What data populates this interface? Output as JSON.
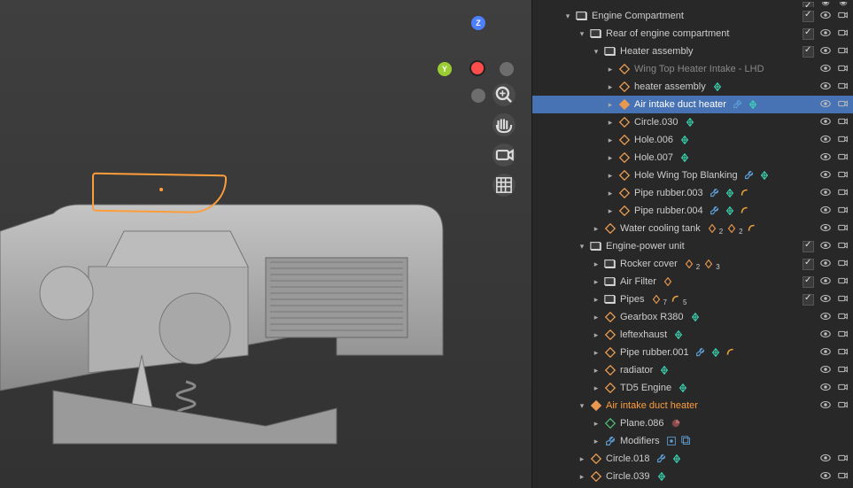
{
  "viewport": {
    "axes": {
      "z": "Z",
      "y": "Y"
    }
  },
  "outliner": {
    "rows": [
      {
        "indent": 2,
        "arrow": "down",
        "type": "collection",
        "label": "Engine Compartment",
        "checkbox": true,
        "eye": true,
        "cam": true
      },
      {
        "indent": 3,
        "arrow": "down",
        "type": "collection",
        "label": "Rear of engine compartment",
        "checkbox": true,
        "eye": true,
        "cam": true
      },
      {
        "indent": 4,
        "arrow": "down",
        "type": "collection",
        "label": "Heater assembly",
        "checkbox": true,
        "eye": true,
        "cam": true
      },
      {
        "indent": 5,
        "arrow": "right",
        "type": "mesh",
        "label": "Wing Top Heater Intake - LHD",
        "muted": true,
        "badges": [],
        "eye": true,
        "cam": true
      },
      {
        "indent": 5,
        "arrow": "right",
        "type": "mesh",
        "label": "heater assembly",
        "badges": [
          "vert-teal"
        ],
        "eye": true,
        "cam": true
      },
      {
        "indent": 5,
        "arrow": "right",
        "type": "mesh",
        "selected": true,
        "orangeIcon": true,
        "orangeText": true,
        "label": "Air intake duct heater",
        "badges": [
          "wrench",
          "vert-teal"
        ],
        "eye": true,
        "cam": true
      },
      {
        "indent": 5,
        "arrow": "right",
        "type": "mesh",
        "label": "Circle.030",
        "badges": [
          "vert-teal"
        ],
        "eye": true,
        "cam": true
      },
      {
        "indent": 5,
        "arrow": "right",
        "type": "mesh",
        "label": "Hole.006",
        "badges": [
          "vert-teal"
        ],
        "eye": true,
        "cam": true
      },
      {
        "indent": 5,
        "arrow": "right",
        "type": "mesh",
        "label": "Hole.007",
        "badges": [
          "vert-teal"
        ],
        "eye": true,
        "cam": true
      },
      {
        "indent": 5,
        "arrow": "right",
        "type": "mesh",
        "label": "Hole Wing Top Blanking",
        "badges": [
          "wrench",
          "vert-teal"
        ],
        "eye": true,
        "cam": true
      },
      {
        "indent": 5,
        "arrow": "right",
        "type": "mesh",
        "label": "Pipe rubber.003",
        "badges": [
          "wrench",
          "vert-teal",
          "curve"
        ],
        "eye": true,
        "cam": true
      },
      {
        "indent": 5,
        "arrow": "right",
        "type": "mesh",
        "label": "Pipe rubber.004",
        "badges": [
          "wrench",
          "vert-teal",
          "curve"
        ],
        "eye": true,
        "cam": true
      },
      {
        "indent": 4,
        "arrow": "right",
        "type": "mesh",
        "label": "Water cooling tank",
        "badges": [
          "vert-orange",
          "sub2",
          "vert-orange",
          "sub2",
          "curve"
        ],
        "eye": true,
        "cam": true
      },
      {
        "indent": 3,
        "arrow": "down",
        "type": "collection",
        "label": "Engine-power unit",
        "checkbox": true,
        "eye": true,
        "cam": true
      },
      {
        "indent": 4,
        "arrow": "right",
        "type": "collection",
        "label": "Rocker cover",
        "badges": [
          "vert-orange",
          "sub2",
          "vert-orange",
          "sub3"
        ],
        "checkbox": true,
        "eye": true,
        "cam": true
      },
      {
        "indent": 4,
        "arrow": "right",
        "type": "collection",
        "label": "Air Filter",
        "badges": [
          "vert-orange"
        ],
        "checkbox": true,
        "eye": true,
        "cam": true
      },
      {
        "indent": 4,
        "arrow": "right",
        "type": "collection",
        "label": "Pipes",
        "badges": [
          "vert-orange",
          "sub7",
          "curve",
          "sub5"
        ],
        "checkbox": true,
        "eye": true,
        "cam": true
      },
      {
        "indent": 4,
        "arrow": "right",
        "type": "mesh",
        "label": "Gearbox R380",
        "badges": [
          "vert-teal"
        ],
        "eye": true,
        "cam": true
      },
      {
        "indent": 4,
        "arrow": "right",
        "type": "mesh",
        "label": "leftexhaust",
        "badges": [
          "vert-teal"
        ],
        "eye": true,
        "cam": true
      },
      {
        "indent": 4,
        "arrow": "right",
        "type": "mesh",
        "label": "Pipe rubber.001",
        "badges": [
          "wrench",
          "vert-teal",
          "curve"
        ],
        "eye": true,
        "cam": true
      },
      {
        "indent": 4,
        "arrow": "right",
        "type": "mesh",
        "label": "radiator",
        "badges": [
          "vert-teal"
        ],
        "eye": true,
        "cam": true
      },
      {
        "indent": 4,
        "arrow": "right",
        "type": "mesh",
        "label": "TD5 Engine",
        "badges": [
          "vert-teal"
        ],
        "eye": true,
        "cam": true
      },
      {
        "indent": 3,
        "arrow": "down",
        "type": "mesh",
        "orangeIcon": true,
        "orangeText": true,
        "label": "Air intake duct heater",
        "eye": true,
        "cam": true
      },
      {
        "indent": 4,
        "arrow": "right",
        "type": "data",
        "label": "Plane.086",
        "badges": [
          "material"
        ]
      },
      {
        "indent": 4,
        "arrow": "right",
        "type": "wrench",
        "label": "Modifiers",
        "badges": [
          "mod1",
          "mod2"
        ]
      },
      {
        "indent": 3,
        "arrow": "right",
        "type": "mesh",
        "label": "Circle.018",
        "badges": [
          "wrench",
          "vert-teal"
        ],
        "eye": true,
        "cam": true
      },
      {
        "indent": 3,
        "arrow": "right",
        "type": "mesh",
        "label": "Circle.039",
        "badges": [
          "vert-teal"
        ],
        "eye": true,
        "cam": true
      }
    ]
  }
}
